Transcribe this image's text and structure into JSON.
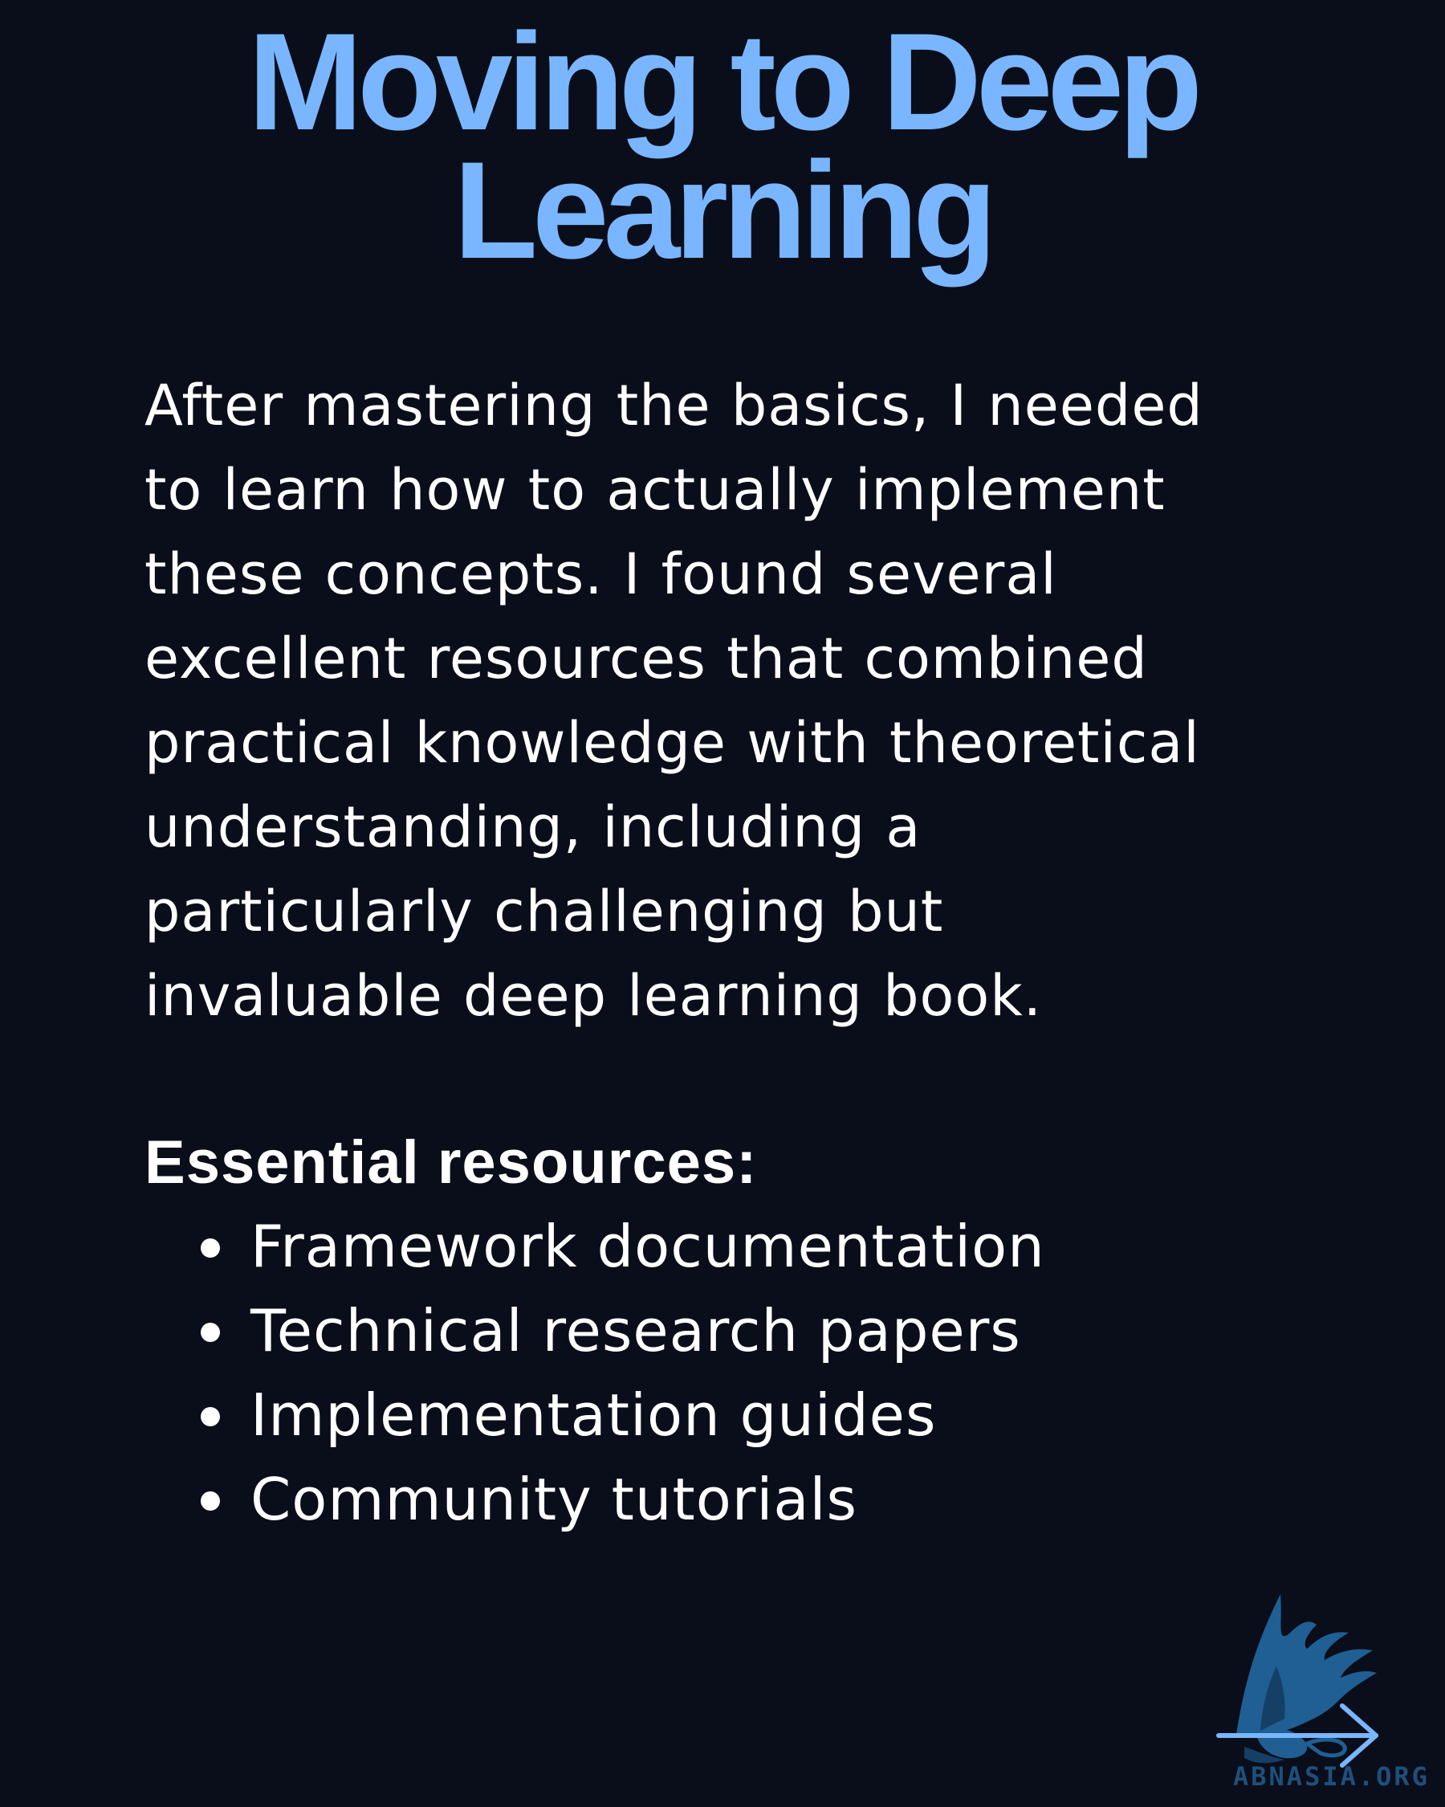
{
  "title": {
    "line1": "Moving to Deep",
    "line2": "Learning"
  },
  "body": {
    "lines": [
      "After mastering the basics, I needed",
      "to learn how to actually implement",
      "these concepts. I found several",
      "excellent resources that combined",
      "practical knowledge with theoretical",
      "understanding, including a",
      "particularly challenging but",
      "invaluable deep learning book."
    ]
  },
  "resources": {
    "heading": "Essential resources:",
    "items": [
      "Framework documentation",
      "Technical research papers",
      "Implementation guides",
      "Community tutorials"
    ]
  },
  "footer": {
    "watermark": "ABNASIA.ORG",
    "logo_icon": "griffin-logo-icon",
    "arrow_icon": "arrow-right-icon"
  },
  "colors": {
    "background": "#0a0e1a",
    "title": "#7ab6ff",
    "text": "#ffffff",
    "logo": "#1f5f93",
    "arrow": "#7ab6ff"
  }
}
